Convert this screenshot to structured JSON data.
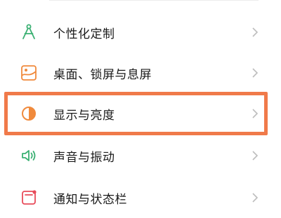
{
  "settings": {
    "items": [
      {
        "label": "个性化定制",
        "icon": "compass-icon",
        "color": "#3bb073"
      },
      {
        "label": "桌面、锁屏与息屏",
        "icon": "wallpaper-icon",
        "color": "#f08a3c"
      },
      {
        "label": "显示与亮度",
        "icon": "brightness-icon",
        "color": "#f08a3c"
      },
      {
        "label": "声音与振动",
        "icon": "speaker-icon",
        "color": "#3bb073"
      },
      {
        "label": "通知与状态栏",
        "icon": "notification-icon",
        "color": "#e84b5a"
      }
    ]
  },
  "highlight": {
    "color": "#f07a4a",
    "target": "显示与亮度"
  }
}
